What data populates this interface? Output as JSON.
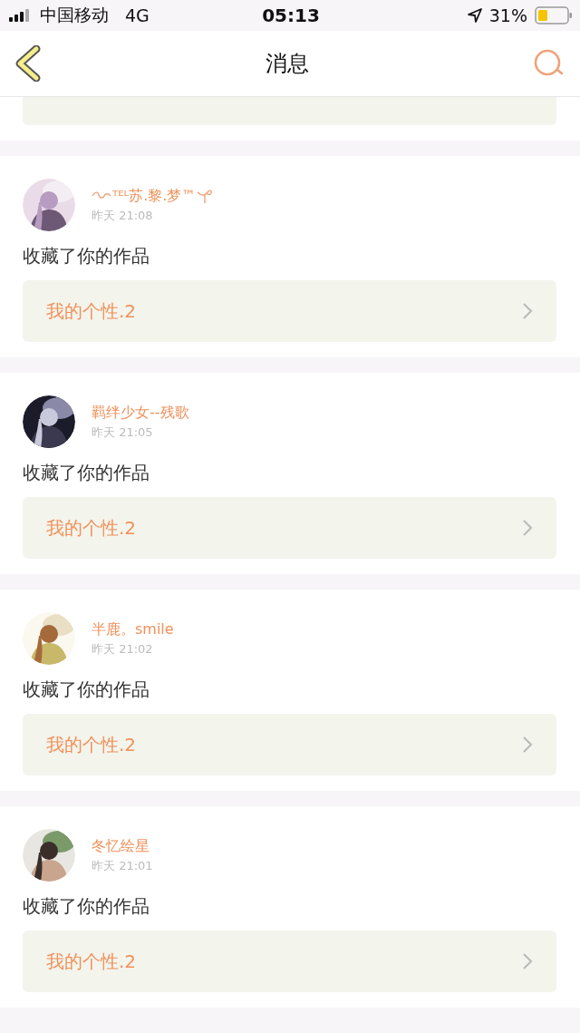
{
  "status_bar": {
    "carrier": "中国移动",
    "network": "4G",
    "time": "05:13",
    "battery": "31%"
  },
  "header": {
    "title": "消息"
  },
  "messages": [
    {
      "name": "ᵀᴱᴸ苏.黎.梦™",
      "ornament": true,
      "time": "昨天 21:08",
      "action": "收藏了你的作品",
      "work": "我的个性.2"
    },
    {
      "name": "羁绊少女--残歌",
      "ornament": false,
      "time": "昨天 21:05",
      "action": "收藏了你的作品",
      "work": "我的个性.2"
    },
    {
      "name": "半鹿。smile",
      "ornament": false,
      "time": "昨天 21:02",
      "action": "收藏了你的作品",
      "work": "我的个性.2"
    },
    {
      "name": "冬忆绘星",
      "ornament": false,
      "time": "昨天 21:01",
      "action": "收藏了你的作品",
      "work": "我的个性.2"
    }
  ]
}
